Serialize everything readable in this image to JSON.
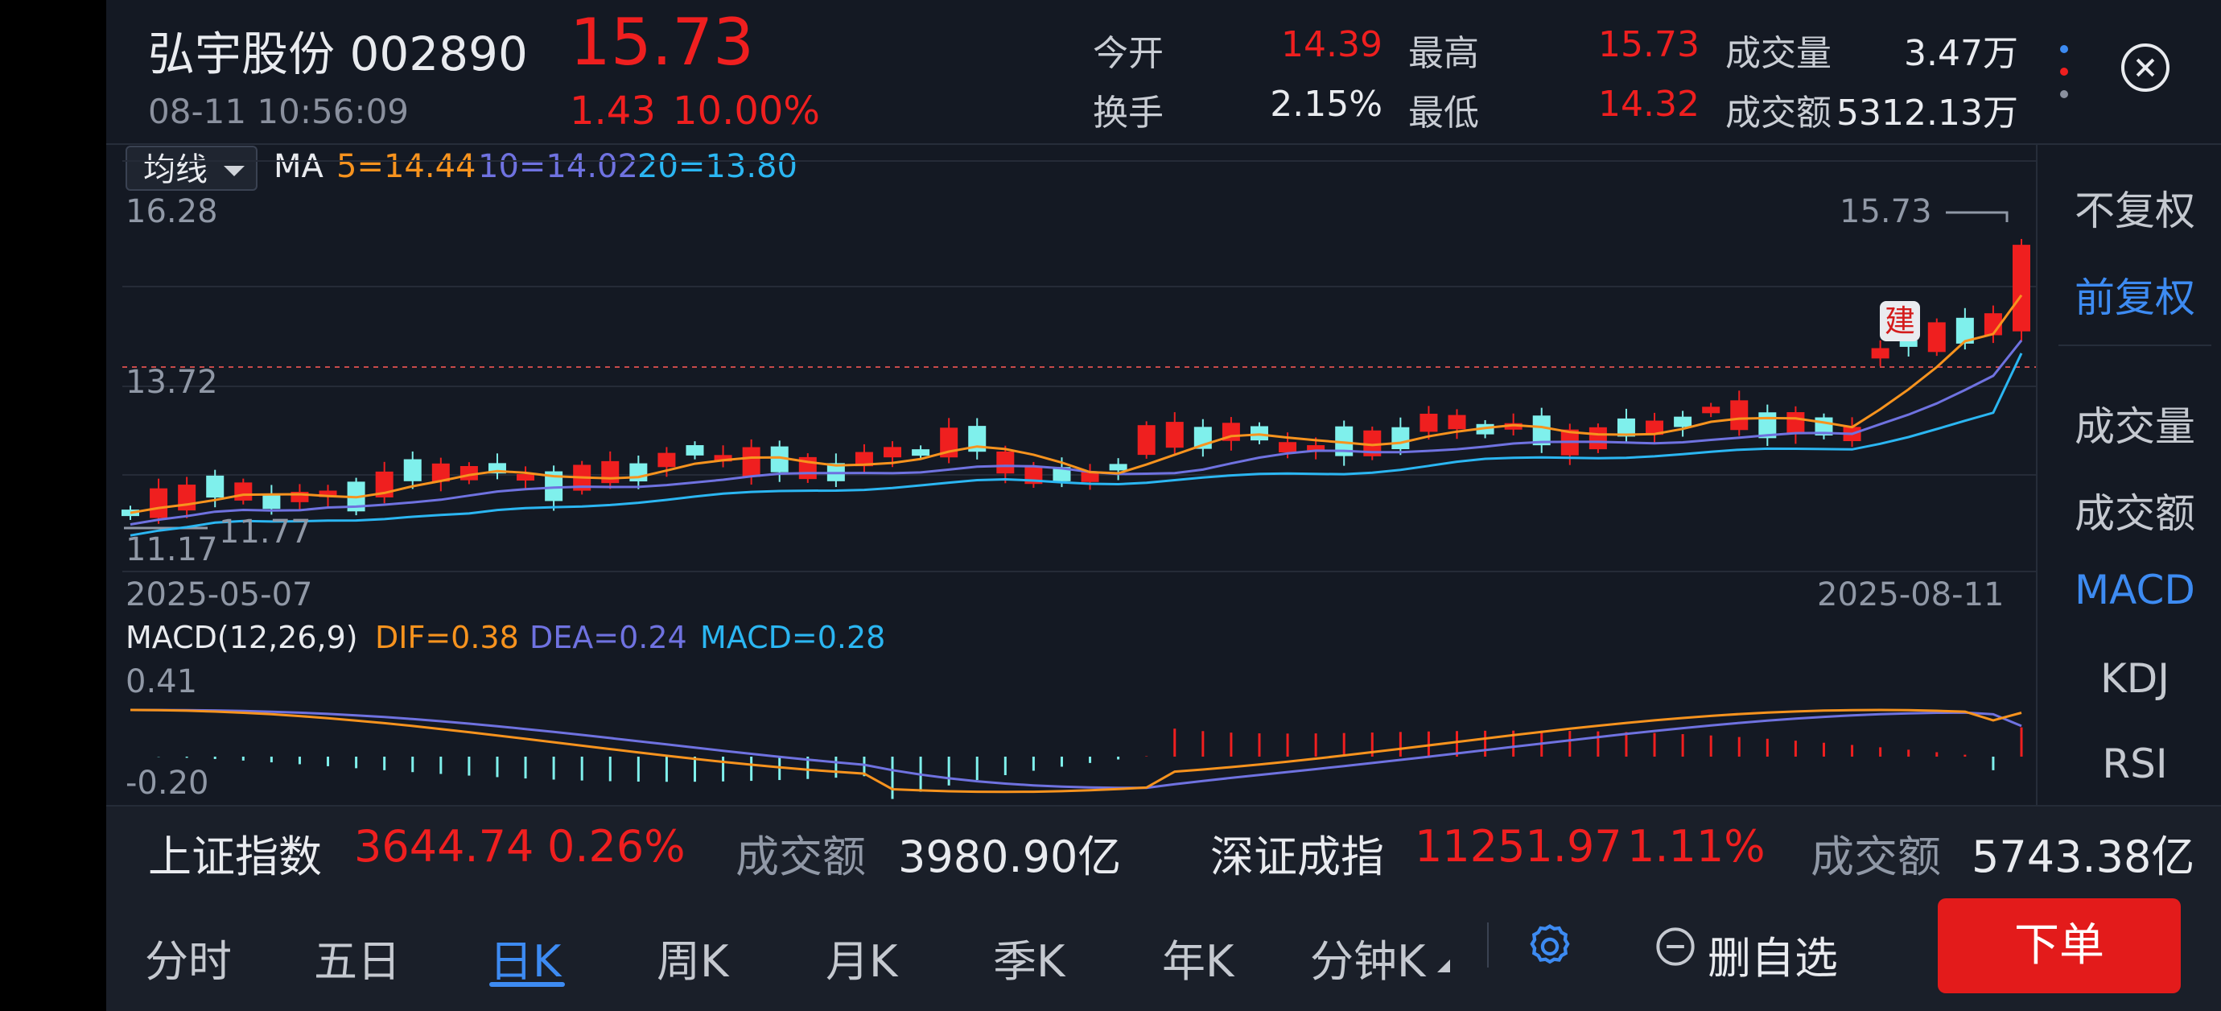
{
  "header": {
    "stock_name": "弘宇股份",
    "stock_code": "002890",
    "price": "15.73",
    "datetime": "08-11 10:56:09",
    "change": "1.43",
    "change_pct": "10.00%",
    "stats": [
      {
        "label": "今开",
        "value": "14.39",
        "color": "red"
      },
      {
        "label": "最高",
        "value": "15.73",
        "color": "red"
      },
      {
        "label": "成交量",
        "value": "3.47万",
        "color": "white"
      },
      {
        "label": "换手",
        "value": "2.15%",
        "color": "white"
      },
      {
        "label": "最低",
        "value": "14.32",
        "color": "red"
      },
      {
        "label": "成交额",
        "value": "5312.13万",
        "color": "white"
      }
    ]
  },
  "ma_bar": {
    "select_label": "均线",
    "prefix": "MA",
    "ma5": "5=14.44",
    "ma10": "10=14.02",
    "ma20": "20=13.80"
  },
  "kline": {
    "y_top": "16.28",
    "y_mid": "13.72",
    "y_low": "11.17",
    "min_label": "11.77",
    "max_label": "15.73",
    "date_start": "2025-05-07",
    "date_end": "2025-08-11",
    "badge": "建"
  },
  "macd": {
    "title": "MACD(12,26,9)",
    "dif": "DIF=0.38",
    "dea": "DEA=0.24",
    "macd": "MACD=0.28",
    "y_top": "0.41",
    "y_bottom": "-0.20"
  },
  "side_menu": [
    "不复权",
    "前复权",
    "成交量",
    "成交额",
    "MACD",
    "KDJ",
    "RSI"
  ],
  "index_bar": {
    "sh_name": "上证指数",
    "sh_value": "3644.74",
    "sh_pct": "0.26%",
    "sh_amount_label": "成交额",
    "sh_amount": "3980.90亿",
    "sz_name": "深证成指",
    "sz_value": "11251.97",
    "sz_pct": "1.11%",
    "sz_amount_label": "成交额",
    "sz_amount": "5743.38亿"
  },
  "tabs": [
    "分时",
    "五日",
    "日K",
    "周K",
    "月K",
    "季K",
    "年K",
    "分钟K"
  ],
  "active_tab": "日K",
  "delete_watch": "删自选",
  "order_button": "下单",
  "colors": {
    "up": "#EF1F1F",
    "down": "#7FF0EC",
    "ma5": "#F7931E",
    "ma10": "#6F72E0",
    "ma20": "#2BB6F2",
    "accent": "#3D8BF2"
  },
  "icons": {
    "close": "close-circle-icon",
    "more": "more-dots-icon",
    "settings": "gear-icon",
    "remove": "minus-circle-icon",
    "dropdown": "caret-down-icon"
  }
}
